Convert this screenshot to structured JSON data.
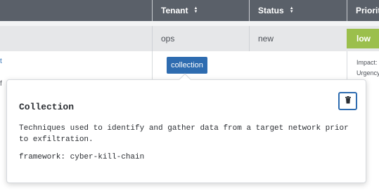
{
  "header": {
    "columns": [
      {
        "label": "Tenant",
        "sort_icon": "sort-icon"
      },
      {
        "label": "Status",
        "sort_icon": "sort-icon"
      },
      {
        "label": "Priority"
      }
    ]
  },
  "row": {
    "tenant": "ops",
    "status": "new",
    "priority": "low",
    "priority_color": "#9bbf4c",
    "left_link_fragment": "t",
    "left_text_fragment": "f",
    "impact_label": "Impact:",
    "urgency_label": "Urgency"
  },
  "tag": {
    "label": "collection",
    "color": "#2e6cb0"
  },
  "popover": {
    "title": "Collection",
    "description": "Techniques used to identify and gather data from a target network prior to exfiltration.",
    "framework": "framework: cyber-kill-chain",
    "delete_icon": "trash-icon"
  }
}
